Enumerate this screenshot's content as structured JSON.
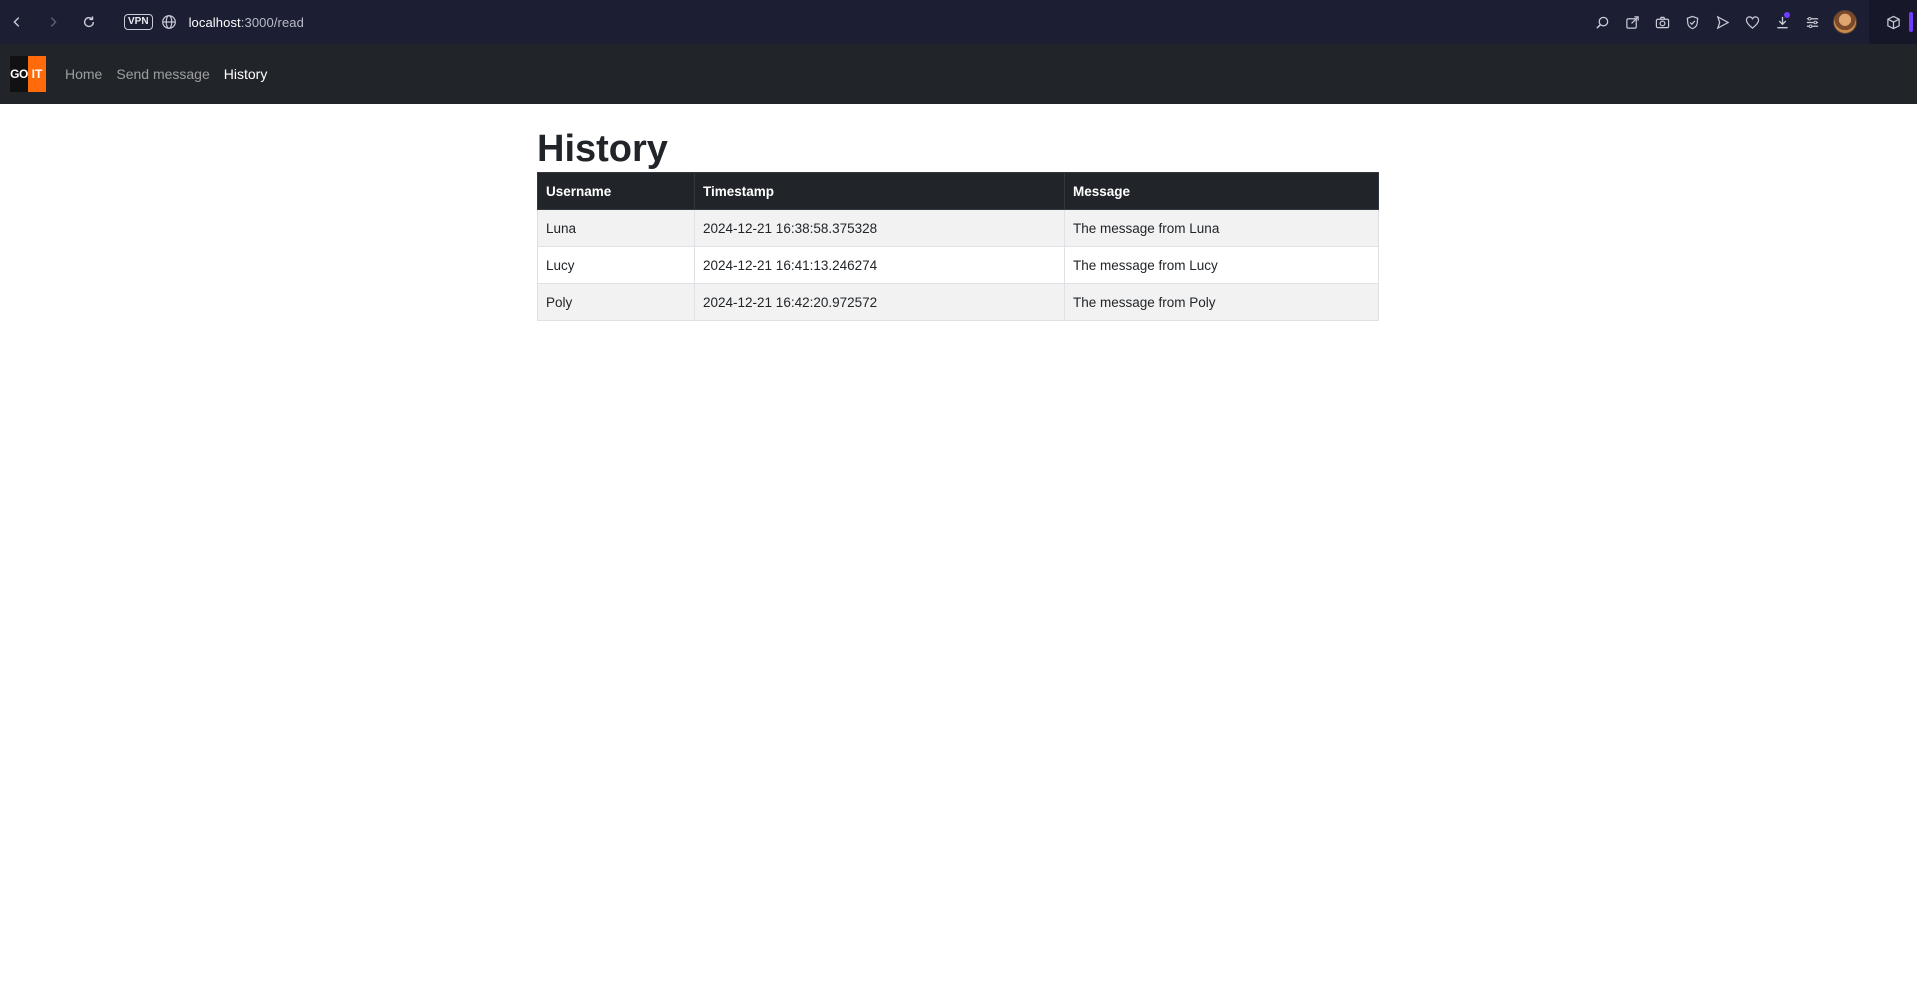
{
  "browser": {
    "vpn_label": "VPN",
    "url_host": "localhost",
    "url_path": ":3000/read",
    "icons": [
      "back-icon",
      "forward-icon",
      "reload-icon",
      "globe-icon",
      "search-icon",
      "share-icon",
      "camera-icon",
      "shield-icon",
      "send-icon",
      "heart-icon",
      "download-icon",
      "menu-icon",
      "cube-icon"
    ],
    "accent_color": "#6d3cff"
  },
  "navbar": {
    "logo_left": "GO",
    "logo_right": "IT",
    "logo_accent": "#ff6b0a",
    "links": [
      {
        "label": "Home",
        "active": false
      },
      {
        "label": "Send message",
        "active": false
      },
      {
        "label": "History",
        "active": true
      }
    ]
  },
  "main": {
    "title": "History",
    "table": {
      "headers": [
        "Username",
        "Timestamp",
        "Message"
      ],
      "rows": [
        [
          "Luna",
          "2024-12-21 16:38:58.375328",
          "The message from Luna"
        ],
        [
          "Lucy",
          "2024-12-21 16:41:13.246274",
          "The message from Lucy"
        ],
        [
          "Poly",
          "2024-12-21 16:42:20.972572",
          "The message from Poly"
        ]
      ]
    }
  }
}
